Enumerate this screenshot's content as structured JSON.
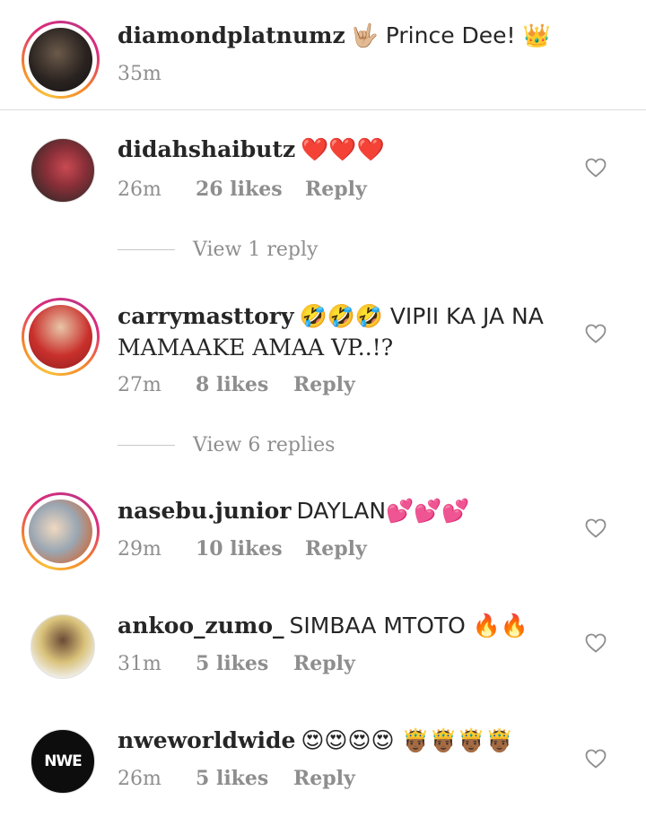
{
  "comments": [
    {
      "username": "diamondplatnumz",
      "text": "🤟🏼 Prince Dee! 👑",
      "time": "35m",
      "likes": "",
      "reply": ""
    },
    {
      "username": "didahshaibutz",
      "text": "❤️❤️❤️",
      "time": "26m",
      "likes": "26 likes",
      "reply": "Reply",
      "view_replies": "View 1 reply"
    },
    {
      "username": "carrymasttory",
      "text_line1": "🤣🤣🤣 VIPII KA JA NA",
      "text_line2": "MAMAAKE AMAA VP..!?",
      "time": "27m",
      "likes": "8 likes",
      "reply": "Reply",
      "view_replies": "View 6 replies"
    },
    {
      "username": "nasebu.junior",
      "text": "DAYLAN💕💕💕",
      "time": "29m",
      "likes": "10 likes",
      "reply": "Reply"
    },
    {
      "username": "ankoo_zumo_",
      "text": "SIMBAA MTOTO 🔥🔥",
      "time": "31m",
      "likes": "5 likes",
      "reply": "Reply"
    },
    {
      "username": "nweworldwide",
      "text": "😍😍😍😍 🤴🏾🤴🏾🤴🏾🤴🏾",
      "time": "26m",
      "likes": "5 likes",
      "reply": "Reply",
      "avatar_logo": "NWE"
    }
  ],
  "colors": {
    "username": "#262626",
    "meta": "#8e8e8e",
    "divider": "#dbdbdb",
    "story_ring": "#dd2a7b"
  },
  "icons": {
    "like": "heart-outline-icon"
  }
}
